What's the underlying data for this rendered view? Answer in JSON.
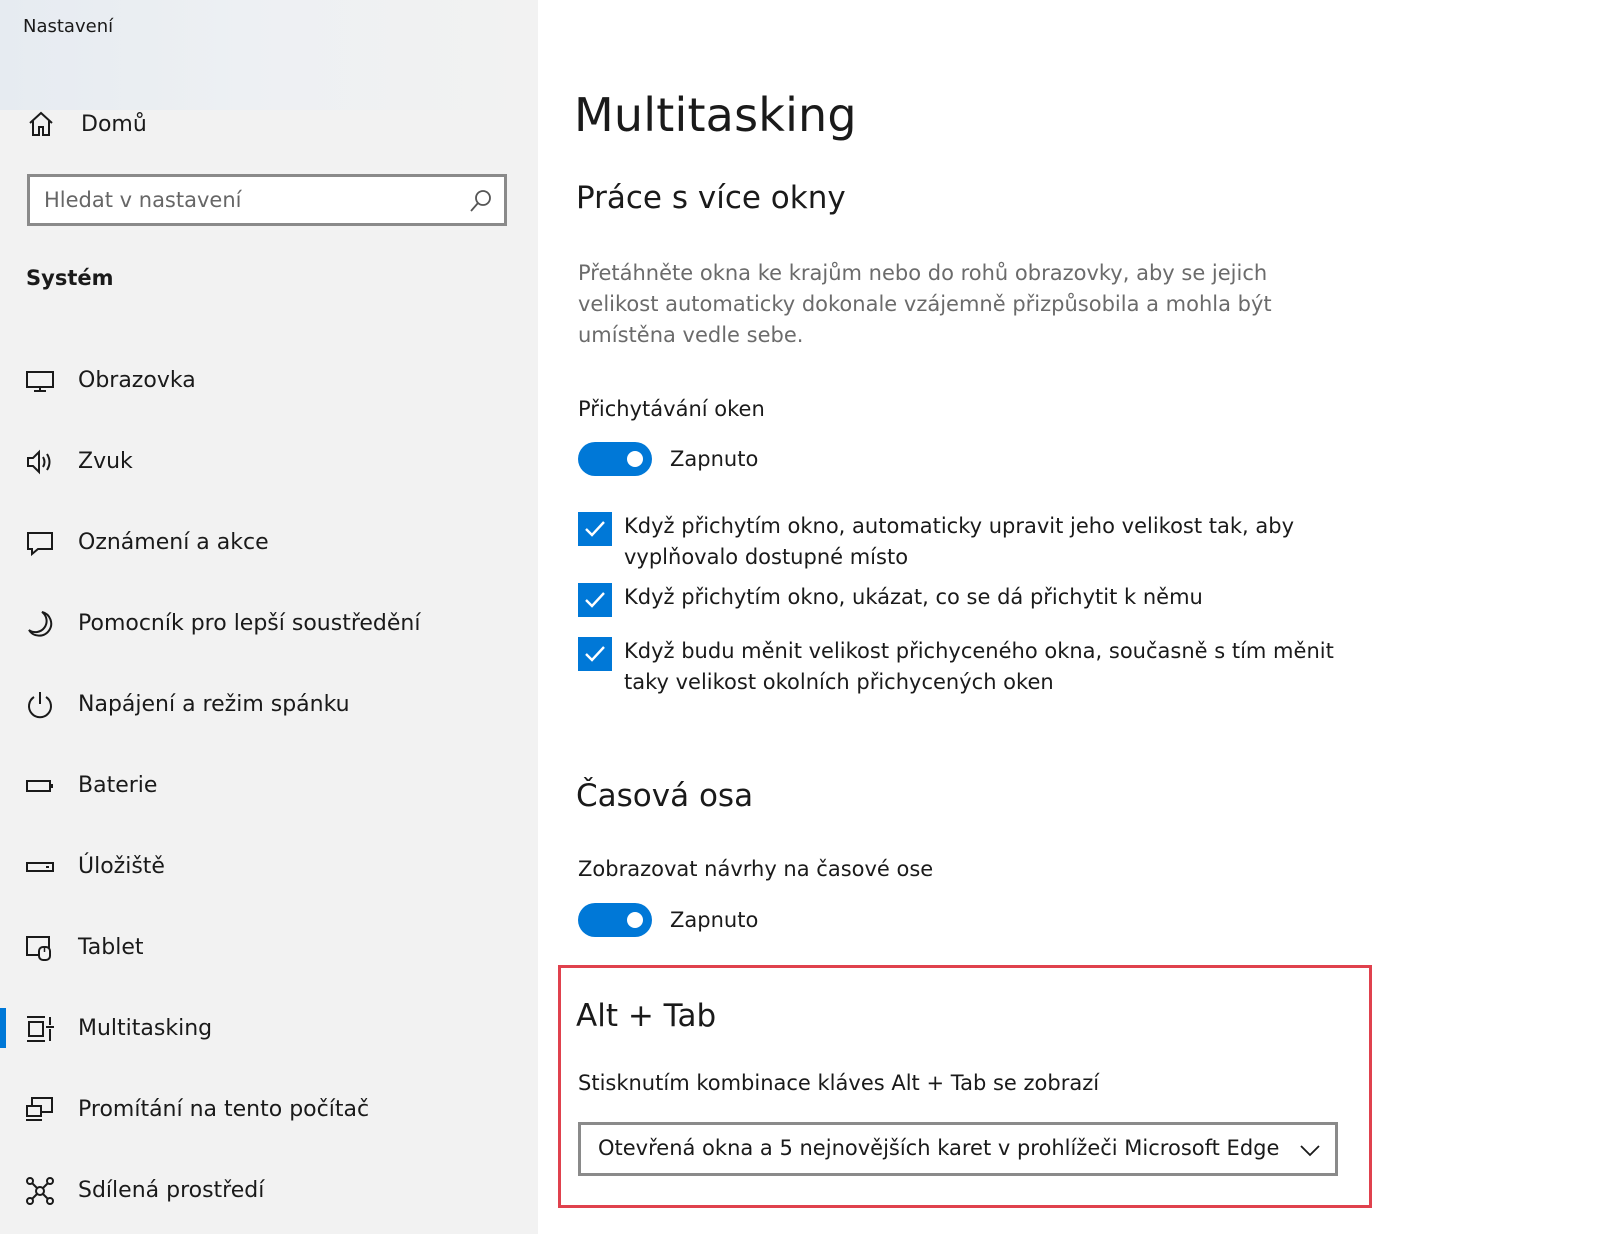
{
  "window": {
    "title": "Nastavení"
  },
  "sidebar": {
    "home_label": "Domů",
    "search": {
      "placeholder": "Hledat v nastavení",
      "value": ""
    },
    "section_title": "Systém",
    "items": [
      {
        "label": "Obrazovka",
        "icon": "monitor-icon"
      },
      {
        "label": "Zvuk",
        "icon": "speaker-icon"
      },
      {
        "label": "Oznámení a akce",
        "icon": "notification-icon"
      },
      {
        "label": "Pomocník pro lepší soustředění",
        "icon": "moon-icon"
      },
      {
        "label": "Napájení a režim spánku",
        "icon": "power-icon"
      },
      {
        "label": "Baterie",
        "icon": "battery-icon"
      },
      {
        "label": "Úložiště",
        "icon": "storage-icon"
      },
      {
        "label": "Tablet",
        "icon": "tablet-icon"
      },
      {
        "label": "Multitasking",
        "icon": "multitasking-icon",
        "selected": true
      },
      {
        "label": "Promítání na tento počítač",
        "icon": "projecting-icon"
      },
      {
        "label": "Sdílená prostředí",
        "icon": "shared-experiences-icon"
      }
    ]
  },
  "main": {
    "title": "Multitasking",
    "snap": {
      "heading": "Práce s více okny",
      "description": "Přetáhněte okna ke krajům nebo do rohů obrazovky, aby se jejich velikost automaticky dokonale vzájemně přizpůsobila a mohla být umístěna vedle sebe.",
      "toggle_label": "Přichytávání oken",
      "toggle_state": "Zapnuto",
      "toggle_on": true,
      "checkboxes": [
        {
          "text": "Když přichytím okno, automaticky upravit jeho velikost tak, aby vyplňovalo dostupné místo",
          "checked": true
        },
        {
          "text": "Když přichytím okno, ukázat, co se dá přichytit k němu",
          "checked": true
        },
        {
          "text": "Když budu měnit velikost přichyceného okna, současně s tím měnit taky velikost okolních přichycených oken",
          "checked": true
        }
      ]
    },
    "timeline": {
      "heading": "Časová osa",
      "toggle_label": "Zobrazovat návrhy na časové ose",
      "toggle_state": "Zapnuto",
      "toggle_on": true
    },
    "alttab": {
      "heading": "Alt + Tab",
      "label": "Stisknutím kombinace kláves Alt + Tab se zobrazí",
      "selected_option": "Otevřená okna a 5 nejnovějších karet v prohlížeči Microsoft Edge"
    }
  },
  "colors": {
    "accent": "#0078d7",
    "highlight": "#e0414d",
    "sidebar_bg": "#f2f2f2"
  }
}
